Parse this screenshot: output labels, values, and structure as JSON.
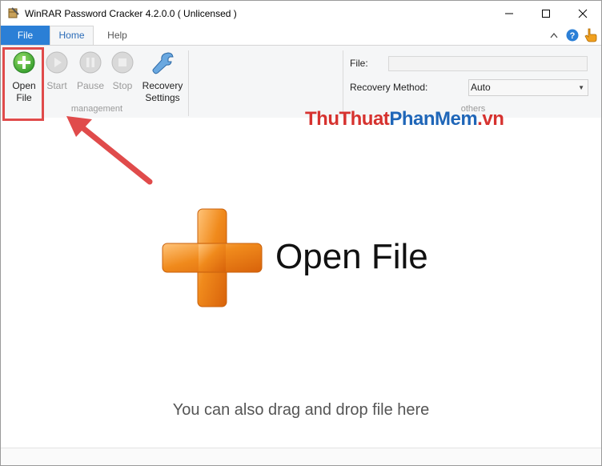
{
  "window": {
    "title": "WinRAR Password Cracker 4.2.0.0  ( Unlicensed )"
  },
  "tabs": {
    "file": "File",
    "home": "Home",
    "help": "Help"
  },
  "ribbon": {
    "buttons": [
      {
        "line1": "Open",
        "line2": "File",
        "icon": "plus-circle-icon",
        "enabled": true
      },
      {
        "line1": "Start",
        "icon": "play-icon",
        "enabled": false
      },
      {
        "line1": "Pause",
        "icon": "pause-icon",
        "enabled": false
      },
      {
        "line1": "Stop",
        "icon": "stop-icon",
        "enabled": false
      },
      {
        "line1": "Recovery",
        "line2": "Settings",
        "icon": "wrench-icon",
        "enabled": true
      }
    ],
    "group_management": "management",
    "group_others": "others",
    "file_label": "File:",
    "file_value": "",
    "recovery_method_label": "Recovery Method:",
    "recovery_method_value": "Auto"
  },
  "watermark": {
    "part1": "ThuThuat",
    "part2": "PhanMem",
    "part3": ".vn"
  },
  "main": {
    "open_file": "Open File",
    "hint": "You can also drag and drop file here"
  },
  "colors": {
    "file_tab": "#2b7fd6",
    "highlight": "#e04b4b",
    "plus_orange": "#f08a1c",
    "plus_green": "#3fae3a"
  }
}
